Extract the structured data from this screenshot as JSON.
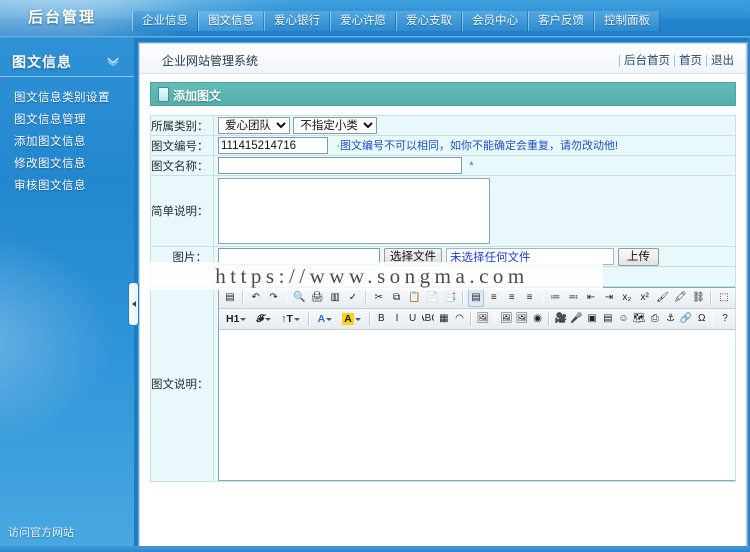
{
  "topbar": {
    "logo": "后台管理",
    "tabs": [
      {
        "label": "企业信息",
        "active": false
      },
      {
        "label": "图文信息",
        "active": true
      },
      {
        "label": "爱心银行",
        "active": false
      },
      {
        "label": "爱心许愿",
        "active": false
      },
      {
        "label": "爱心支取",
        "active": false
      },
      {
        "label": "会员中心",
        "active": false
      },
      {
        "label": "客户反馈",
        "active": false
      },
      {
        "label": "控制面板",
        "active": false
      }
    ]
  },
  "sidebar": {
    "title": "图文信息",
    "collapse_icon": "chevron-down-icon",
    "items": [
      {
        "label": "图文信息类别设置"
      },
      {
        "label": "图文信息管理"
      },
      {
        "label": "添加图文信息"
      },
      {
        "label": "修改图文信息"
      },
      {
        "label": "审核图文信息"
      }
    ],
    "footer_link": "访问官方网站"
  },
  "content_header": {
    "system_name": "企业网站管理系统",
    "links": [
      "后台首页",
      "首页",
      "退出"
    ],
    "separator": "|"
  },
  "panel": {
    "title": "添加图文",
    "icon": "page-icon"
  },
  "form": {
    "category": {
      "label": "所属类别：",
      "main_value": "爱心团队",
      "main_options": [
        "爱心团队"
      ],
      "sub_value": "不指定小类",
      "sub_options": [
        "不指定小类"
      ]
    },
    "code": {
      "label": "图文编号：",
      "value": "111415214716",
      "note": "图文编号不可以相同，如你不能确定会重复，请勿改动他!"
    },
    "name": {
      "label": "图文名称：",
      "value": "",
      "placeholder": "",
      "required_mark": "*"
    },
    "brief": {
      "label": "简单说明：",
      "value": "",
      "placeholder": ""
    },
    "image": {
      "label": "图片：",
      "value": "",
      "choose_button": "选择文件",
      "no_file_text": "未选择任何文件",
      "upload_button": "上传"
    },
    "description": {
      "label": "图文说明：",
      "value": ""
    }
  },
  "editor": {
    "toolbar_row1": [
      {
        "name": "source-icon",
        "glyph": "▤"
      },
      {
        "sep": true
      },
      {
        "name": "undo-icon",
        "glyph": "↶"
      },
      {
        "name": "redo-icon",
        "glyph": "↷"
      },
      {
        "sep": true
      },
      {
        "name": "preview-icon",
        "glyph": "🔍"
      },
      {
        "name": "print-icon",
        "glyph": "🖨"
      },
      {
        "name": "templates-icon",
        "glyph": "▥"
      },
      {
        "name": "spellcheck-icon",
        "glyph": "✓"
      },
      {
        "sep": true
      },
      {
        "name": "cut-icon",
        "glyph": "✂"
      },
      {
        "name": "copy-icon",
        "glyph": "⧉"
      },
      {
        "name": "paste-icon",
        "glyph": "📋"
      },
      {
        "name": "paste-text-icon",
        "glyph": "📄"
      },
      {
        "name": "paste-word-icon",
        "glyph": "📑"
      },
      {
        "sep": true
      },
      {
        "name": "justify-block-icon",
        "glyph": "▤",
        "active": true
      },
      {
        "name": "align-left-icon",
        "glyph": "≡"
      },
      {
        "name": "align-center-icon",
        "glyph": "≡"
      },
      {
        "name": "align-right-icon",
        "glyph": "≡"
      },
      {
        "sep": true
      },
      {
        "name": "ordered-list-icon",
        "glyph": "≔"
      },
      {
        "name": "unordered-list-icon",
        "glyph": "≕"
      },
      {
        "name": "outdent-icon",
        "glyph": "⇤"
      },
      {
        "name": "indent-icon",
        "glyph": "⇥"
      },
      {
        "name": "subscript-icon",
        "glyph": "x₂"
      },
      {
        "name": "superscript-icon",
        "glyph": "x²"
      },
      {
        "name": "remove-format-icon",
        "glyph": "🖌"
      },
      {
        "name": "format-painter-icon",
        "glyph": "🖍"
      },
      {
        "name": "unlink-icon",
        "glyph": "⛓"
      },
      {
        "sep": true
      },
      {
        "name": "show-blocks-icon",
        "glyph": "⬚"
      }
    ],
    "toolbar_row2": [
      {
        "name": "format-dropdown",
        "label": "H1",
        "dropdown": true
      },
      {
        "name": "font-dropdown",
        "label": "𝓕",
        "dropdown": true
      },
      {
        "name": "fontsize-dropdown",
        "label": "↑T",
        "dropdown": true
      },
      {
        "sep": true
      },
      {
        "name": "text-color-dropdown",
        "label": "A",
        "dropdown": true,
        "color": "#2a6fd6"
      },
      {
        "name": "bg-color-dropdown",
        "label": "A",
        "dropdown": true,
        "highlight": "#ffd21a"
      },
      {
        "sep": true
      },
      {
        "name": "bold-icon",
        "glyph": "B"
      },
      {
        "name": "italic-icon",
        "glyph": "I"
      },
      {
        "name": "underline-icon",
        "glyph": "U"
      },
      {
        "name": "strike-icon",
        "glyph": "ABC"
      },
      {
        "name": "table-icon",
        "glyph": "▦"
      },
      {
        "name": "eraser-icon",
        "glyph": "◠"
      },
      {
        "sep": true
      },
      {
        "name": "image-upload-icon",
        "glyph": "🖼"
      },
      {
        "sep": true
      },
      {
        "name": "image-icon",
        "glyph": "🖼"
      },
      {
        "name": "image-batch-icon",
        "glyph": "🖼"
      },
      {
        "name": "flash-icon",
        "glyph": "◉"
      },
      {
        "sep": true
      },
      {
        "name": "video-icon",
        "glyph": "🎥"
      },
      {
        "name": "audio-icon",
        "glyph": "🎤"
      },
      {
        "name": "iframe-icon",
        "glyph": "▣"
      },
      {
        "name": "form-icon",
        "glyph": "▤"
      },
      {
        "name": "smiley-icon",
        "glyph": "☺"
      },
      {
        "name": "map-icon",
        "glyph": "🗺"
      },
      {
        "name": "page-break-icon",
        "glyph": "⎙"
      },
      {
        "name": "anchor-icon",
        "glyph": "⚓"
      },
      {
        "name": "link-icon",
        "glyph": "🔗"
      },
      {
        "name": "special-char-icon",
        "glyph": "Ω"
      },
      {
        "sep": true
      },
      {
        "name": "about-icon",
        "glyph": "?"
      }
    ]
  },
  "watermark": {
    "text": "https://www.songma.com"
  }
}
